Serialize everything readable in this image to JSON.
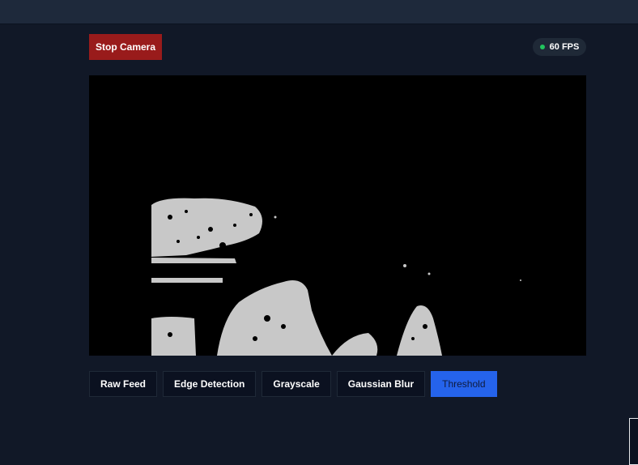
{
  "controls": {
    "stop_camera_label": "Stop Camera",
    "fps_label": "60 FPS",
    "fps_status_color": "#22c55e",
    "stop_color": "#991b1b"
  },
  "filters": [
    {
      "label": "Raw Feed",
      "active": false
    },
    {
      "label": "Edge Detection",
      "active": false
    },
    {
      "label": "Grayscale",
      "active": false
    },
    {
      "label": "Gaussian Blur",
      "active": false
    },
    {
      "label": "Threshold",
      "active": true
    }
  ],
  "accent_color": "#2563eb"
}
